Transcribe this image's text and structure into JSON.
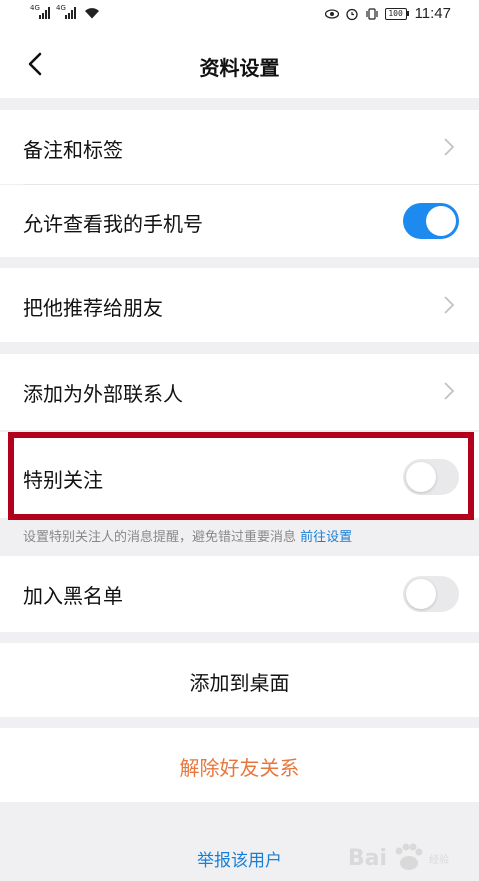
{
  "status_bar": {
    "signal1_tag": "4G",
    "signal2_tag": "4G",
    "battery": "100",
    "time": "11:47"
  },
  "nav": {
    "title": "资料设置"
  },
  "rows": {
    "remark": "备注和标签",
    "allow_phone": "允许查看我的手机号",
    "recommend": "把他推荐给朋友",
    "add_external": "添加为外部联系人",
    "special_follow": "特别关注",
    "blacklist": "加入黑名单",
    "add_desktop": "添加到桌面",
    "remove_friend": "解除好友关系",
    "report": "举报该用户"
  },
  "toggles": {
    "allow_phone": true,
    "special_follow": false,
    "blacklist": false
  },
  "hint": {
    "text": "设置特别关注人的消息提醒，避免错过重要消息 ",
    "link": "前往设置"
  },
  "watermark": {
    "brand": "Bai",
    "sub": "经验"
  },
  "colors": {
    "accent_blue": "#1d8af0",
    "link_blue": "#1a7fd4",
    "danger_orange": "#e8773d",
    "highlight_red": "#b3001b"
  }
}
